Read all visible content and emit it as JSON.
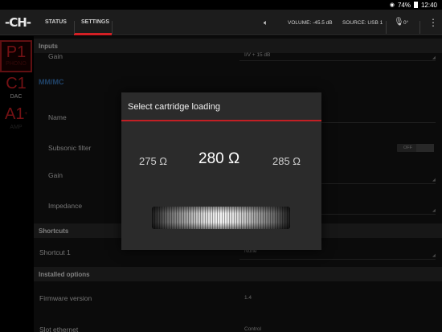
{
  "statusbar": {
    "battery": "74%",
    "time": "12:40"
  },
  "appbar": {
    "logo": "-CH-",
    "tabs": [
      {
        "label": "STATUS"
      },
      {
        "label": "SETTINGS"
      }
    ],
    "volume": "VOLUME: -45.5 dB",
    "source": "SOURCE: USB 1",
    "mic_value": "0°"
  },
  "rail": [
    {
      "code": "P1",
      "label": "PHONO"
    },
    {
      "code": "C1",
      "label": "DAC"
    },
    {
      "code": "A1",
      "label": "AMP"
    }
  ],
  "settings": {
    "inputs_header": "Inputs",
    "gain_top_label": "Gain",
    "gain_top_value": "I/V + 15 dB",
    "mmmc_title": "MM/MC",
    "name_label": "Name",
    "subsonic_label": "Subsonic filter",
    "subsonic_state": "OFF",
    "gain_label": "Gain",
    "impedance_label": "Impedance",
    "shortcuts_header": "Shortcuts",
    "shortcut1_label": "Shortcut 1",
    "shortcut1_value": "None",
    "installed_header": "Installed options",
    "firmware_label": "Firmware version",
    "firmware_value": "1.4",
    "slot_label": "Slot ethernet",
    "slot_value": "Control"
  },
  "dialog": {
    "title": "Select cartridge loading",
    "prev_value": "275 Ω",
    "current_value": "280 Ω",
    "next_value": "285 Ω"
  },
  "colors": {
    "accent_red": "#d32025",
    "section_blue": "#3b7bbf"
  }
}
